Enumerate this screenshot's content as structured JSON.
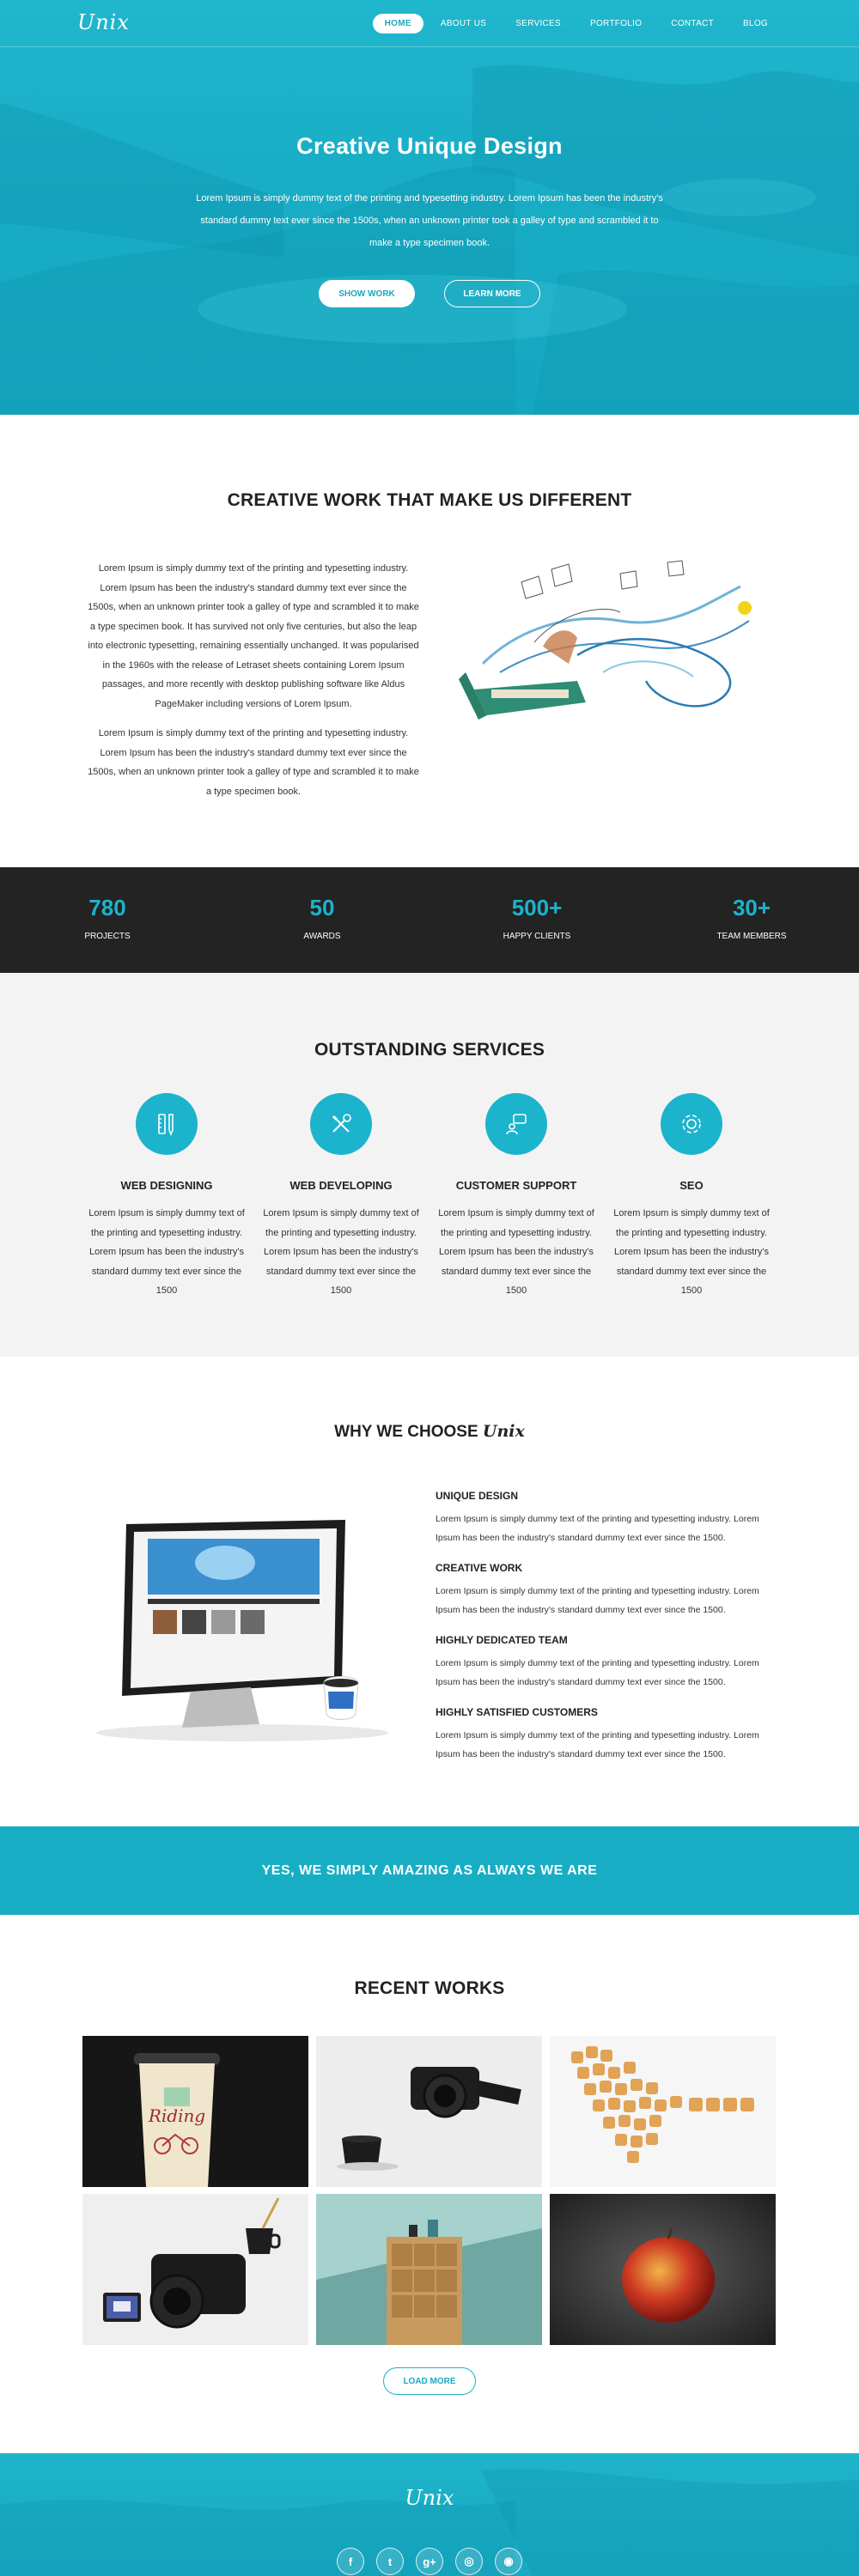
{
  "brand": {
    "logo": "Unix"
  },
  "nav": {
    "items": [
      "HOME",
      "ABOUT US",
      "SERVICES",
      "PORTFOLIO",
      "CONTACT",
      "BLOG"
    ],
    "active": "HOME"
  },
  "hero": {
    "title": "Creative Unique Design",
    "text": "Lorem Ipsum is simply dummy text of the printing and typesetting industry. Lorem Ipsum has been the industry's standard dummy text ever since the 1500s, when an unknown printer took a galley of type and scrambled it to make a type specimen book.",
    "show_work": "SHOW WORK",
    "learn_more": "LEARN MORE"
  },
  "creative": {
    "title": "CREATIVE WORK THAT MAKE US DIFFERENT",
    "para1": "Lorem Ipsum is simply dummy text of the printing and typesetting industry. Lorem Ipsum has been the industry's standard dummy text ever since the 1500s, when an unknown printer took a galley of type and scrambled it to make a type specimen book. It has survived not only five centuries, but also the leap into electronic typesetting, remaining essentially unchanged. It was popularised in the 1960s with the release of Letraset sheets containing Lorem Ipsum passages, and more recently with desktop publishing software like Aldus PageMaker including versions of Lorem Ipsum.",
    "para2": "Lorem Ipsum is simply dummy text of the printing and typesetting industry. Lorem Ipsum has been the industry's standard dummy text ever since the 1500s, when an unknown printer took a galley of type and scrambled it to make a type specimen book."
  },
  "stats": [
    {
      "value": "780",
      "label": "PROJECTS"
    },
    {
      "value": "50",
      "label": "AWARDS"
    },
    {
      "value": "500+",
      "label": "HAPPY CLIENTS"
    },
    {
      "value": "30+",
      "label": "TEAM MEMBERS"
    }
  ],
  "services": {
    "title": "OUTSTANDING SERVICES",
    "items": [
      {
        "icon": "design-tools-icon",
        "title": "WEB DESIGNING",
        "text": "Lorem Ipsum is simply dummy text of the printing and typesetting industry. Lorem Ipsum has been the industry's standard dummy text ever since the 1500"
      },
      {
        "icon": "wrench-screwdriver-icon",
        "title": "WEB DEVELOPING",
        "text": "Lorem Ipsum is simply dummy text of the printing and typesetting industry. Lorem Ipsum has been the industry's standard dummy text ever since the 1500"
      },
      {
        "icon": "support-chat-icon",
        "title": "CUSTOMER SUPPORT",
        "text": "Lorem Ipsum is simply dummy text of the printing and typesetting industry. Lorem Ipsum has been the industry's standard dummy text ever since the 1500"
      },
      {
        "icon": "gear-icon",
        "title": "SEO",
        "text": "Lorem Ipsum is simply dummy text of the printing and typesetting industry. Lorem Ipsum has been the industry's standard dummy text ever since the 1500"
      }
    ]
  },
  "why": {
    "title_prefix": "WHY WE CHOOSE",
    "title_brand": "Unix",
    "items": [
      {
        "title": "UNIQUE DESIGN",
        "text": "Lorem Ipsum is simply dummy text of the printing and typesetting industry. Lorem Ipsum has been the industry's standard dummy text ever since the 1500."
      },
      {
        "title": "CREATIVE WORK",
        "text": "Lorem Ipsum is simply dummy text of the printing and typesetting industry. Lorem Ipsum has been the industry's standard dummy text ever since the 1500."
      },
      {
        "title": "HIGHLY DEDICATED TEAM",
        "text": "Lorem Ipsum is simply dummy text of the printing and typesetting industry. Lorem Ipsum has been the industry's standard dummy text ever since the 1500."
      },
      {
        "title": "HIGHLY SATISFIED CUSTOMERS",
        "text": "Lorem Ipsum is simply dummy text of the printing and typesetting industry. Lorem Ipsum has been the industry's standard dummy text ever since the 1500."
      }
    ]
  },
  "banner": {
    "text": "YES, WE SIMPLY AMAZING AS ALWAYS WE ARE"
  },
  "works": {
    "title": "RECENT WORKS",
    "cup_text": "Riding",
    "load_more": "LOAD MORE"
  },
  "footer": {
    "logo": "Unix",
    "socials": [
      {
        "icon": "facebook-icon",
        "glyph": "f"
      },
      {
        "icon": "twitter-icon",
        "glyph": "t"
      },
      {
        "icon": "google-plus-icon",
        "glyph": "g+"
      },
      {
        "icon": "instagram-icon",
        "glyph": "◎"
      },
      {
        "icon": "rss-icon",
        "glyph": "◉"
      }
    ]
  },
  "colors": {
    "accent": "#1cb3cc",
    "dark": "#232323",
    "light_bg": "#f3f3f3"
  }
}
